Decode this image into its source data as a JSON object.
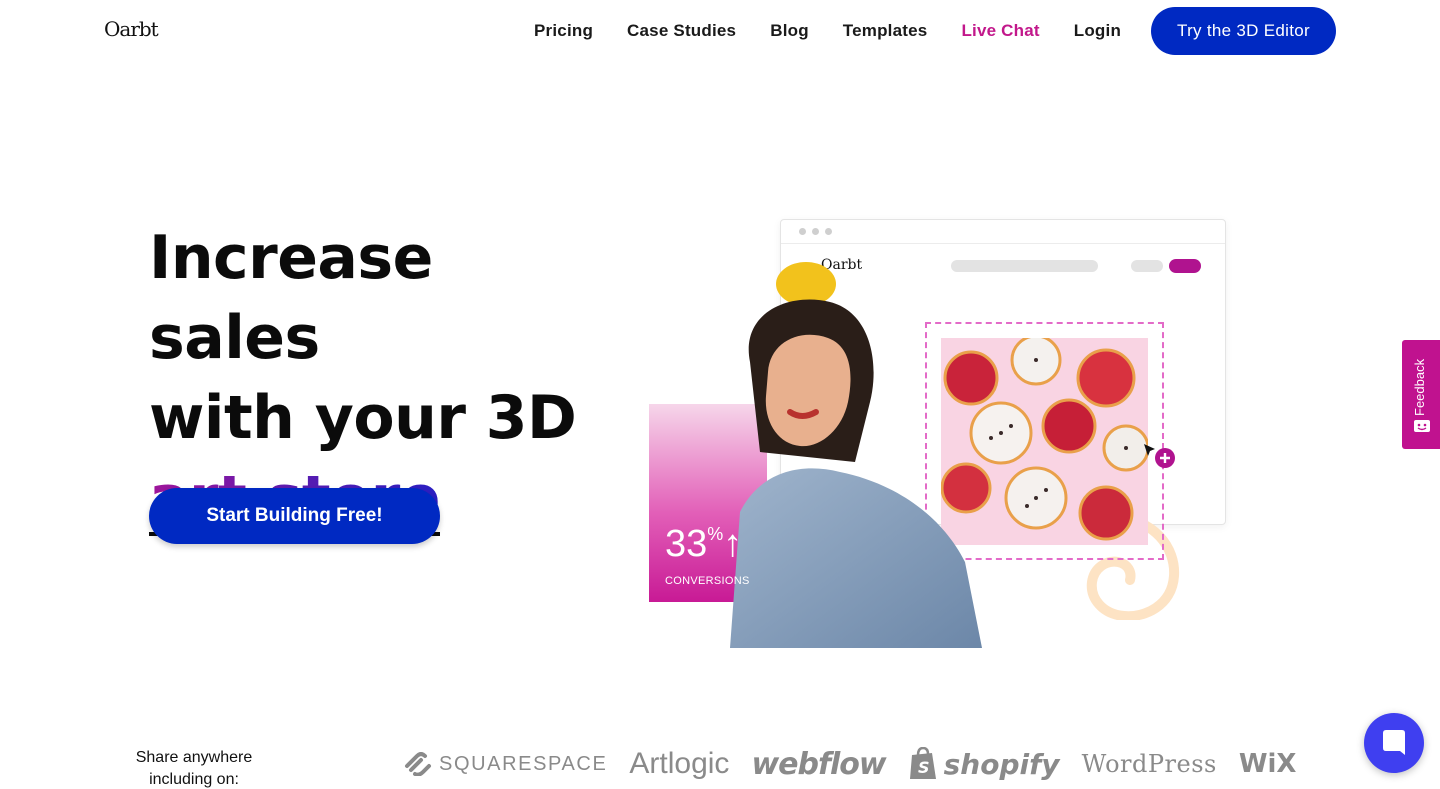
{
  "header": {
    "logo": "Oarbt",
    "nav": [
      "Pricing",
      "Case Studies",
      "Blog",
      "Templates",
      "Live Chat",
      "Login"
    ],
    "cta": "Try the 3D Editor"
  },
  "hero": {
    "line1": "Increase sales",
    "line2": "with your 3D",
    "highlight": "art store",
    "button": "Start Building Free!"
  },
  "illustration": {
    "logo": "Oarbt",
    "stat_value": "33",
    "stat_unit": "%",
    "stat_arrow": "↑",
    "stat_label": "CONVERSIONS"
  },
  "feedback": {
    "label": "Feedback"
  },
  "share": {
    "text": "Share anywhere including on:"
  },
  "partners": {
    "squarespace": "SQUARESPACE",
    "artlogic": "Artlogic",
    "webflow": "webflow",
    "shopify": "shopify",
    "wordpress": "WordPress",
    "wix": "WiX"
  },
  "colors": {
    "primary_blue": "#0029c2",
    "magenta": "#c2188b",
    "chat_purple": "#3f3ff0"
  }
}
